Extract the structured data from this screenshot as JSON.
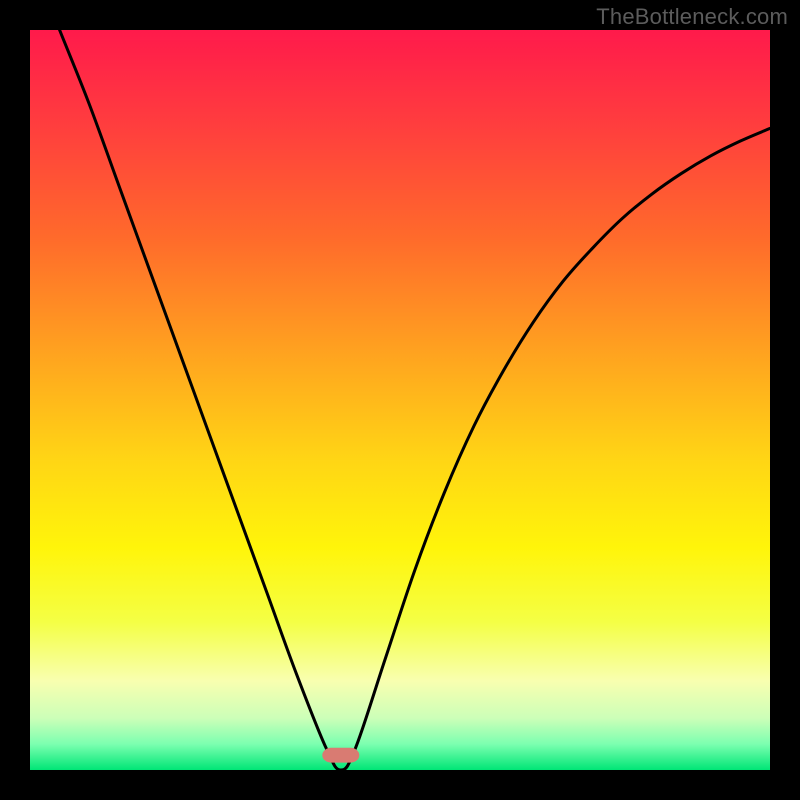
{
  "watermark": "TheBottleneck.com",
  "chart_data": {
    "type": "line",
    "title": "",
    "xlabel": "",
    "ylabel": "",
    "xlim": [
      0,
      100
    ],
    "ylim": [
      0,
      100
    ],
    "bottleneck_x": 42,
    "gradient_stops": [
      {
        "offset": 0.0,
        "color": "#ff1a4b"
      },
      {
        "offset": 0.12,
        "color": "#ff3b3f"
      },
      {
        "offset": 0.28,
        "color": "#ff6a2b"
      },
      {
        "offset": 0.44,
        "color": "#ffa41f"
      },
      {
        "offset": 0.58,
        "color": "#ffd515"
      },
      {
        "offset": 0.7,
        "color": "#fff50a"
      },
      {
        "offset": 0.8,
        "color": "#f4ff45"
      },
      {
        "offset": 0.88,
        "color": "#f8ffb0"
      },
      {
        "offset": 0.93,
        "color": "#ccffb8"
      },
      {
        "offset": 0.965,
        "color": "#7cffb0"
      },
      {
        "offset": 1.0,
        "color": "#00e676"
      }
    ],
    "marker": {
      "x": 42,
      "y": 2,
      "width": 5,
      "height": 2,
      "color": "#d97b72",
      "rx": 1.2
    },
    "series": [
      {
        "name": "bottleneck-curve",
        "x": [
          0,
          4,
          8,
          12,
          16,
          20,
          24,
          28,
          32,
          36,
          40,
          42,
          44,
          48,
          52,
          56,
          60,
          64,
          68,
          72,
          76,
          80,
          84,
          88,
          92,
          96,
          100
        ],
        "values": [
          110,
          100,
          90,
          79,
          68,
          57,
          46,
          35,
          24,
          13,
          3,
          0,
          3,
          15,
          27,
          37.5,
          46.5,
          54,
          60.5,
          66,
          70.5,
          74.5,
          77.8,
          80.6,
          83,
          85,
          86.7
        ]
      }
    ]
  }
}
